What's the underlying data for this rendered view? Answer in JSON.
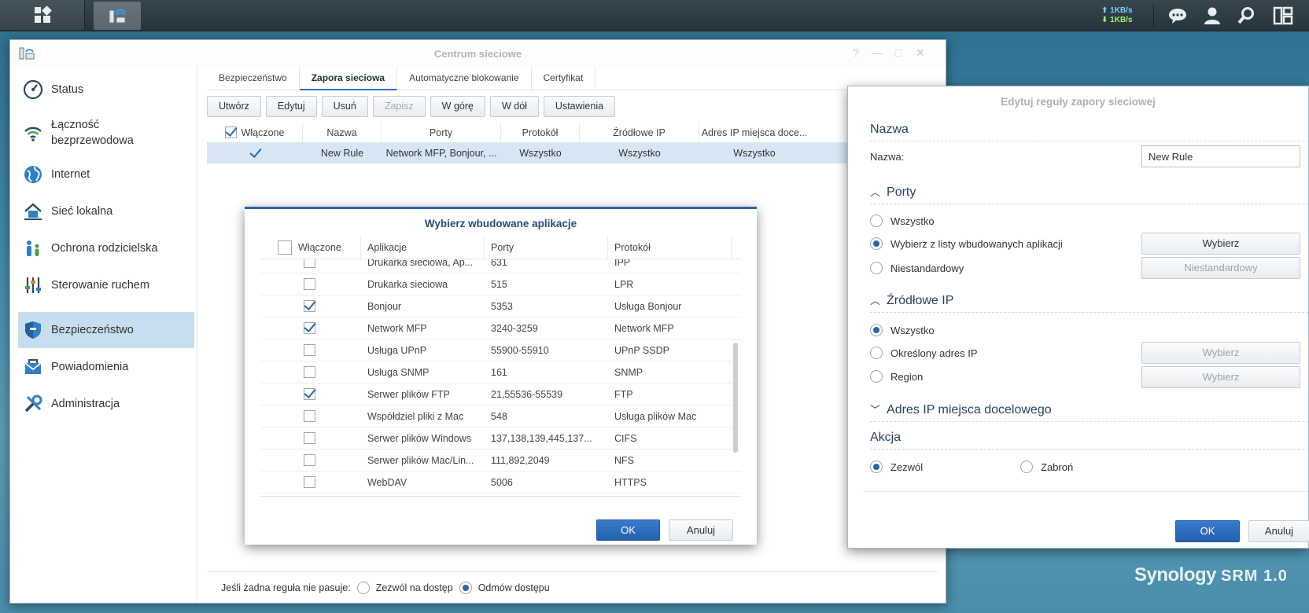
{
  "taskbar": {
    "speed_up": "1KB/s",
    "speed_down": "1KB/s",
    "icons": [
      "main-menu-icon",
      "network-center-app-icon",
      "chat-icon",
      "user-icon",
      "search-icon",
      "widgets-icon"
    ]
  },
  "window": {
    "title": "Centrum sieciowe",
    "controls": [
      "?",
      "—",
      "□",
      "✕"
    ]
  },
  "sidebar": {
    "items": [
      {
        "label": "Status",
        "icon": "gauge-icon"
      },
      {
        "label": "Łączność\nbezprzewodowa",
        "icon": "wifi-icon"
      },
      {
        "label": "Internet",
        "icon": "globe-icon"
      },
      {
        "label": "Sieć lokalna",
        "icon": "home-network-icon"
      },
      {
        "label": "Ochrona rodzicielska",
        "icon": "family-icon"
      },
      {
        "label": "Sterowanie ruchem",
        "icon": "sliders-icon"
      },
      {
        "label": "Bezpieczeństwo",
        "icon": "shield-icon"
      },
      {
        "label": "Powiadomienia",
        "icon": "envelope-icon"
      },
      {
        "label": "Administracja",
        "icon": "tools-icon"
      }
    ],
    "active": "Bezpieczeństwo"
  },
  "tabs": [
    "Bezpieczeństwo",
    "Zapora sieciowa",
    "Automatyczne blokowanie",
    "Certyfikat"
  ],
  "active_tab": "Zapora sieciowa",
  "toolbar": {
    "create": "Utwórz",
    "edit": "Edytuj",
    "delete": "Usuń",
    "save": "Zapisz",
    "up": "W górę",
    "down": "W dół",
    "settings": "Ustawienia"
  },
  "rules_table": {
    "headers": [
      "Włączone",
      "Nazwa",
      "Porty",
      "Protokół",
      "Źródłowe IP",
      "Adres IP miejsca doce..."
    ],
    "rows": [
      {
        "enabled": true,
        "name": "New Rule",
        "ports": "Network MFP, Bonjour, ...",
        "protocol": "Wszystko",
        "source_ip": "Wszystko",
        "dest_ip": "Wszystko"
      }
    ]
  },
  "footer": {
    "label": "Jeśli żadna reguła nie pasuje:",
    "allow": "Zezwól na dostęp",
    "deny": "Odmów dostępu",
    "selected": "deny"
  },
  "picker": {
    "title": "Wybierz wbudowane aplikacje",
    "headers": [
      "Włączone",
      "Aplikacje",
      "Porty",
      "Protokół"
    ],
    "rows": [
      {
        "enabled": false,
        "app": "Drukarka sieciowa, Ap...",
        "ports": "631",
        "protocol": "IPP"
      },
      {
        "enabled": false,
        "app": "Drukarka sieciowa",
        "ports": "515",
        "protocol": "LPR"
      },
      {
        "enabled": true,
        "app": "Bonjour",
        "ports": "5353",
        "protocol": "Usługa Bonjour"
      },
      {
        "enabled": true,
        "app": "Network MFP",
        "ports": "3240-3259",
        "protocol": "Network MFP"
      },
      {
        "enabled": false,
        "app": "Usługa UPnP",
        "ports": "55900-55910",
        "protocol": "UPnP SSDP"
      },
      {
        "enabled": false,
        "app": "Usługa SNMP",
        "ports": "161",
        "protocol": "SNMP"
      },
      {
        "enabled": true,
        "app": "Serwer plików FTP",
        "ports": "21,55536-55539",
        "protocol": "FTP"
      },
      {
        "enabled": false,
        "app": "Współdziel pliki z Mac",
        "ports": "548",
        "protocol": "Usługa plików Mac"
      },
      {
        "enabled": false,
        "app": "Serwer plików Windows",
        "ports": "137,138,139,445,137...",
        "protocol": "CIFS"
      },
      {
        "enabled": false,
        "app": "Serwer plików Mac/Lin...",
        "ports": "111,892,2049",
        "protocol": "NFS"
      },
      {
        "enabled": false,
        "app": "WebDAV",
        "ports": "5006",
        "protocol": "HTTPS"
      }
    ],
    "ok": "OK",
    "cancel": "Anuluj"
  },
  "editor": {
    "title": "Edytuj reguły zapory sieciowej",
    "name_section": "Nazwa",
    "name_label": "Nazwa:",
    "name_value": "New Rule",
    "ports_section": "Porty",
    "ports_all": "Wszystko",
    "ports_builtin": "Wybierz z listy wbudowanych aplikacji",
    "ports_custom": "Niestandardowy",
    "ports_selected": "builtin",
    "btn_select": "Wybierz",
    "btn_custom": "Niestandardowy",
    "src_section": "Źródłowe IP",
    "src_all": "Wszystko",
    "src_specific": "Określony adres IP",
    "src_region": "Region",
    "src_selected": "all",
    "dest_section": "Adres IP miejsca docelowego",
    "action_section": "Akcja",
    "action_allow": "Zezwól",
    "action_deny": "Zabroń",
    "action_selected": "allow",
    "ok": "OK",
    "cancel": "Anuluj"
  },
  "brand": {
    "name": "Synology",
    "product": "SRM 1.0"
  },
  "colors": {
    "accent": "#2d64a8",
    "selection": "#c7ddf0",
    "row_selected": "#d6e6f5"
  }
}
